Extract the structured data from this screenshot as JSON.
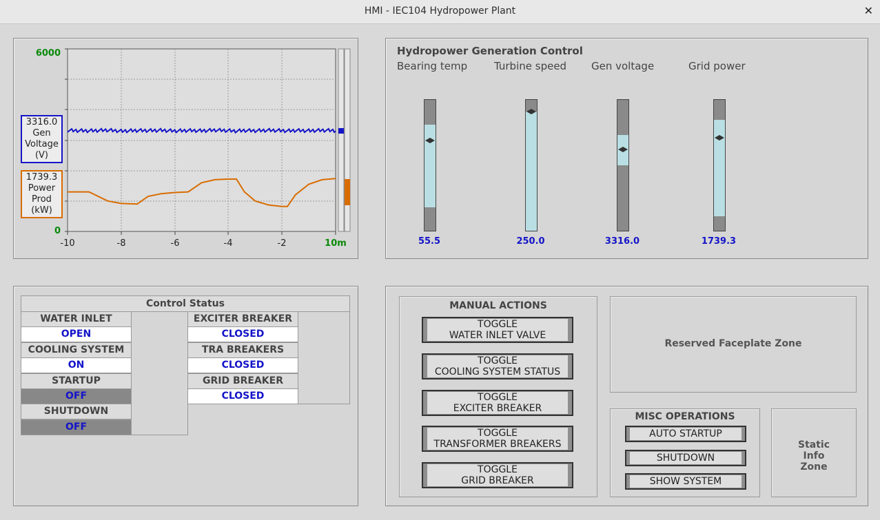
{
  "window": {
    "title": "HMI - IEC104 Hydropower Plant",
    "close_glyph": "✕"
  },
  "trend": {
    "y_max": "6000",
    "y_min": "0",
    "x_ticks": [
      "-10",
      "-8",
      "-6",
      "-4",
      "-2",
      "10m"
    ],
    "voltage": {
      "value": "3316.0",
      "line1": "Gen",
      "line2": "Voltage",
      "unit": "(V)",
      "color": "#1414c8"
    },
    "power": {
      "value": "1739.3",
      "line1": "Power",
      "line2": "Prod",
      "unit": "(kW)",
      "color": "#d86c00"
    }
  },
  "chart_data": {
    "type": "line",
    "x": [
      -10,
      -9.2,
      -8.5,
      -8,
      -7.4,
      -7,
      -6.5,
      -6,
      -5.5,
      -5,
      -4.5,
      -4,
      -3.7,
      -3.4,
      -3,
      -2.5,
      -2,
      -1.8,
      -1.5,
      -1,
      -0.5,
      0
    ],
    "series": [
      {
        "name": "Gen Voltage (V)",
        "values": [
          3320,
          3310,
          3330,
          3300,
          3320,
          3315,
          3325,
          3305,
          3320,
          3310,
          3330,
          3315,
          3300,
          3320,
          3310,
          3325,
          3315,
          3305,
          3320,
          3310,
          3325,
          3316
        ]
      },
      {
        "name": "Power Prod (kW)",
        "values": [
          1300,
          1300,
          1000,
          920,
          900,
          1150,
          1240,
          1280,
          1300,
          1600,
          1700,
          1720,
          1720,
          1300,
          1000,
          870,
          820,
          820,
          1200,
          1550,
          1700,
          1739
        ]
      }
    ],
    "xlabel": "",
    "ylabel": "",
    "ylim": [
      0,
      6000
    ],
    "xlim": [
      -10,
      0
    ],
    "grid": true
  },
  "gen": {
    "title": "Hydropower Generation Control",
    "items": [
      {
        "label": "Bearing temp",
        "value": "55.5",
        "fill_from": 0.19,
        "fill_to": 0.82,
        "marker": 0.31
      },
      {
        "label": "Turbine speed",
        "value": "250.0",
        "fill_from": 0.09,
        "fill_to": 1.0,
        "marker": 0.09
      },
      {
        "label": "Gen voltage",
        "value": "3316.0",
        "fill_from": 0.27,
        "fill_to": 0.5,
        "marker": 0.38
      },
      {
        "label": "Grid power",
        "value": "1739.3",
        "fill_from": 0.15,
        "fill_to": 0.89,
        "marker": 0.29
      }
    ]
  },
  "status": {
    "title": "Control Status",
    "left": [
      {
        "label": "WATER INLET",
        "value": "OPEN"
      },
      {
        "label": "COOLING SYSTEM",
        "value": "ON"
      },
      {
        "label": "STARTUP",
        "value": "OFF"
      },
      {
        "label": "SHUTDOWN",
        "value": "OFF"
      }
    ],
    "right": [
      {
        "label": "EXCITER BREAKER",
        "value": "CLOSED"
      },
      {
        "label": "TRA BREAKERS",
        "value": "CLOSED"
      },
      {
        "label": "GRID BREAKER",
        "value": "CLOSED"
      }
    ]
  },
  "manual": {
    "title": "MANUAL ACTIONS",
    "buttons": [
      {
        "l1": "TOGGLE",
        "l2": "WATER INLET VALVE"
      },
      {
        "l1": "TOGGLE",
        "l2": "COOLING SYSTEM STATUS"
      },
      {
        "l1": "TOGGLE",
        "l2": "EXCITER BREAKER"
      },
      {
        "l1": "TOGGLE",
        "l2": "TRANSFORMER BREAKERS"
      },
      {
        "l1": "TOGGLE",
        "l2": "GRID BREAKER"
      }
    ]
  },
  "reserved": {
    "text": "Reserved Faceplate Zone"
  },
  "misc": {
    "title": "MISC OPERATIONS",
    "buttons": [
      "AUTO STARTUP",
      "SHUTDOWN",
      "SHOW SYSTEM"
    ]
  },
  "static_info": {
    "l1": "Static",
    "l2": "Info",
    "l3": "Zone"
  }
}
